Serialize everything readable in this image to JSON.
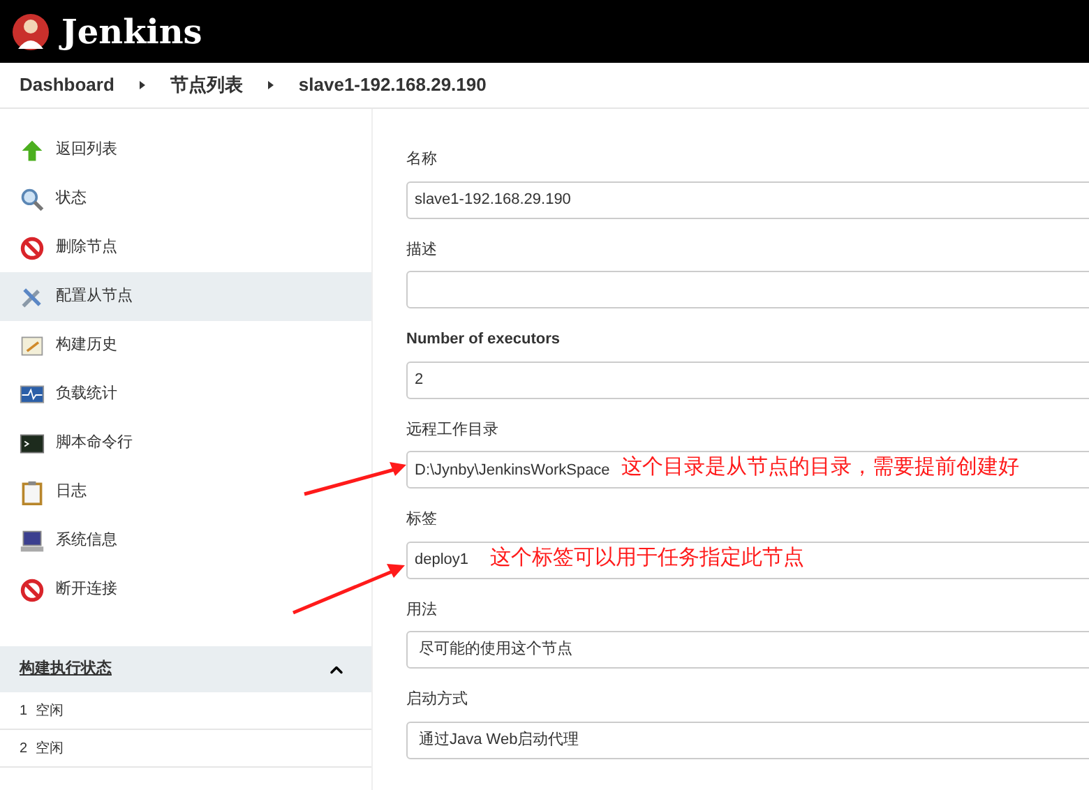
{
  "header": {
    "title": "Jenkins"
  },
  "breadcrumbs": [
    {
      "label": "Dashboard"
    },
    {
      "label": "节点列表"
    },
    {
      "label": "slave1-192.168.29.190"
    }
  ],
  "sidebar": {
    "items": [
      {
        "label": "返回列表",
        "kind": "up",
        "selected": false
      },
      {
        "label": "状态",
        "kind": "search",
        "selected": false
      },
      {
        "label": "删除节点",
        "kind": "forbid",
        "selected": false
      },
      {
        "label": "配置从节点",
        "kind": "tools",
        "selected": true
      },
      {
        "label": "构建历史",
        "kind": "notepad",
        "selected": false
      },
      {
        "label": "负载统计",
        "kind": "monitor",
        "selected": false
      },
      {
        "label": "脚本命令行",
        "kind": "terminal",
        "selected": false
      },
      {
        "label": "日志",
        "kind": "clipboard",
        "selected": false
      },
      {
        "label": "系统信息",
        "kind": "computer",
        "selected": false
      },
      {
        "label": "断开连接",
        "kind": "forbid",
        "selected": false
      }
    ]
  },
  "executors": {
    "title": "构建执行状态",
    "expanded": true,
    "rows": [
      {
        "number": "1",
        "status": "空闲"
      },
      {
        "number": "2",
        "status": "空闲"
      }
    ]
  },
  "form": {
    "fields": [
      {
        "label": "名称",
        "kind": "text",
        "value": "slave1-192.168.29.190"
      },
      {
        "label": "描述",
        "kind": "text"
      },
      {
        "label": "Number of executors",
        "kind": "text",
        "value": "2"
      },
      {
        "label": "远程工作目录",
        "kind": "text",
        "value": "D:\\Jynby\\JenkinsWorkSpace",
        "annotation": "这个目录是从节点的目录，需要提前创建好"
      },
      {
        "label": "标签",
        "kind": "text",
        "value": "deploy1",
        "annotation": "这个标签可以用于任务指定此节点"
      },
      {
        "label": "用法",
        "kind": "select",
        "value": "尽可能的使用这个节点"
      },
      {
        "label": "启动方式",
        "kind": "select",
        "value": "通过Java Web启动代理"
      }
    ]
  }
}
